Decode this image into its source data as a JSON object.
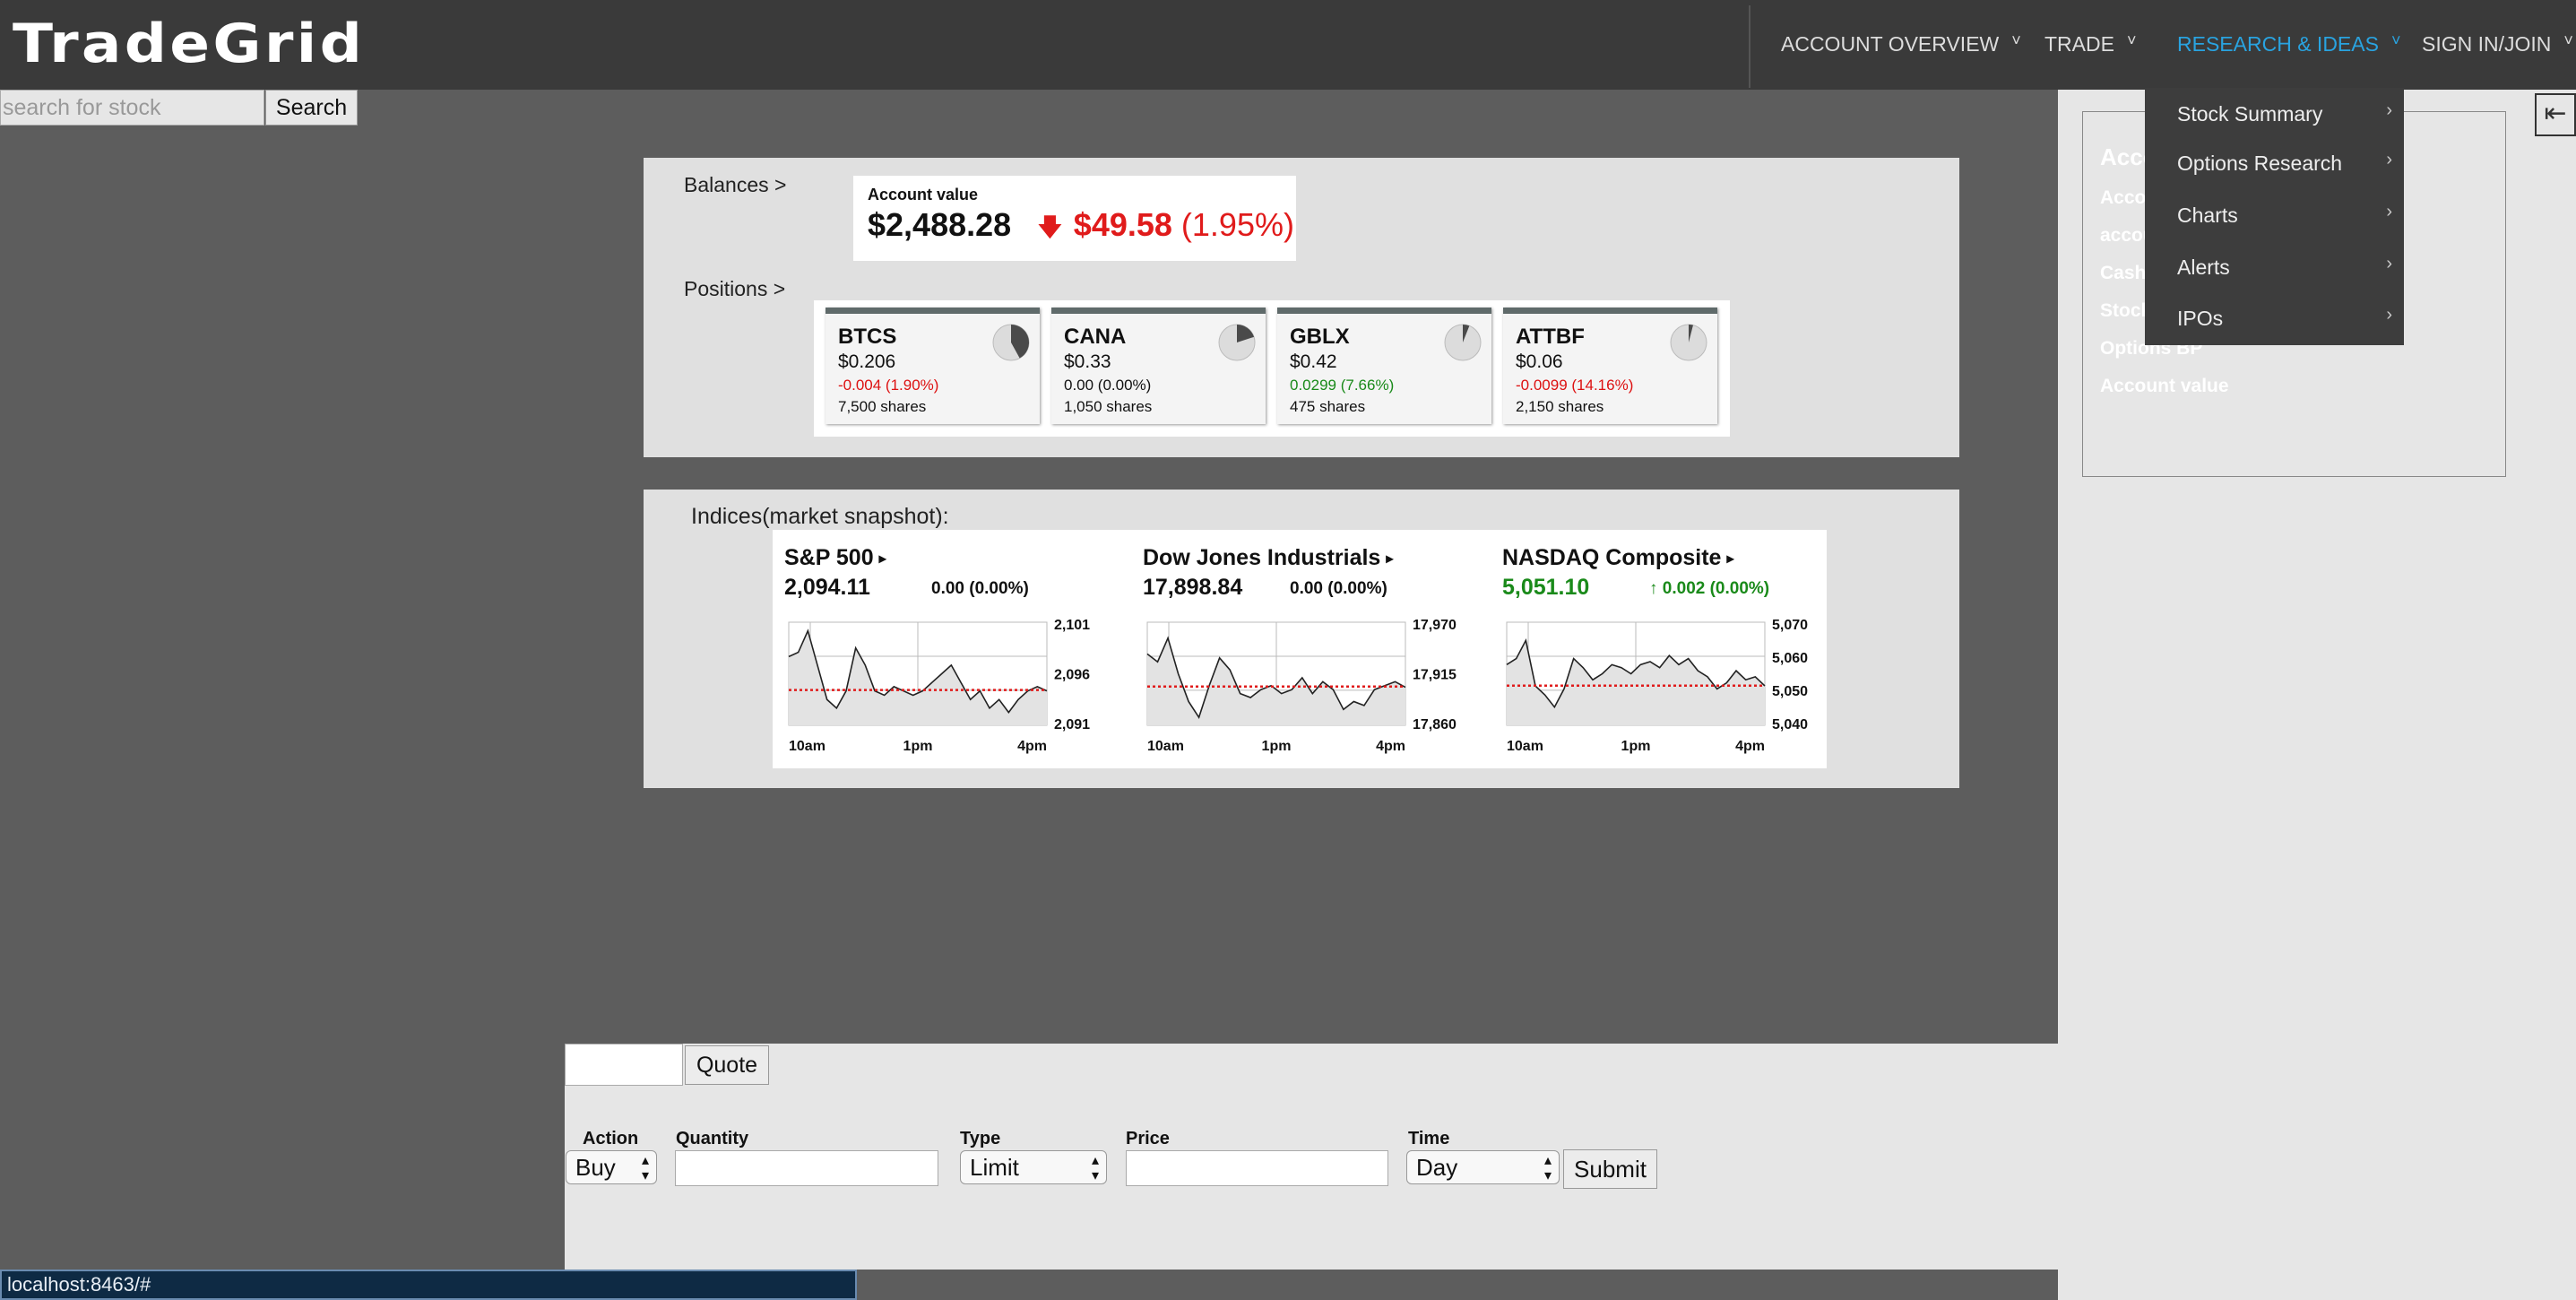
{
  "app": {
    "logo": "TradeGrid"
  },
  "nav": {
    "items": [
      {
        "label": "ACCOUNT OVERVIEW",
        "active": false
      },
      {
        "label": "TRADE",
        "active": false
      },
      {
        "label": "RESEARCH & IDEAS",
        "active": true
      },
      {
        "label": "SIGN IN/JOIN",
        "active": false
      }
    ],
    "chevron": "˅"
  },
  "dropdown": {
    "items": [
      "Stock Summary",
      "Options Research",
      "Charts",
      "Alerts",
      "IPOs"
    ],
    "chevron": "›"
  },
  "search": {
    "placeholder": "search for stock",
    "button": "Search"
  },
  "account_sidebar": {
    "lines": [
      "Acco",
      "Acco",
      "accou",
      "Cash",
      "Stock",
      "Options BP",
      "Account value"
    ],
    "collapse_icon": "⇤"
  },
  "balances": {
    "label": "Balances >",
    "account_value_label": "Account value",
    "account_value": "$2,488.28",
    "change_amount": "$49.58",
    "change_percent": "(1.95%)",
    "change_arrow": "🡇",
    "change_direction": "down"
  },
  "positions": {
    "label": "Positions >",
    "items": [
      {
        "symbol": "BTCS",
        "price": "$0.206",
        "change": "-0.004 (1.90%)",
        "direction": "neg",
        "shares": "7,500 shares",
        "pie_fraction": 0.42
      },
      {
        "symbol": "CANA",
        "price": "$0.33",
        "change": "0.00 (0.00%)",
        "direction": "flat",
        "shares": "1,050 shares",
        "pie_fraction": 0.2
      },
      {
        "symbol": "GBLX",
        "price": "$0.42",
        "change": "0.0299 (7.66%)",
        "direction": "pos",
        "shares": "475 shares",
        "pie_fraction": 0.06
      },
      {
        "symbol": "ATTBF",
        "price": "$0.06",
        "change": "-0.0099 (14.16%)",
        "direction": "neg",
        "shares": "2,150 shares",
        "pie_fraction": 0.04
      }
    ]
  },
  "indices": {
    "label": "Indices(market snapshot):",
    "items": [
      {
        "name": "S&P 500",
        "value": "2,094.11",
        "change": "0.00 (0.00%)",
        "direction": "flat",
        "yticks": [
          "2,101",
          "2,096",
          "2,091"
        ],
        "xticks": [
          "10am",
          "1pm",
          "4pm"
        ]
      },
      {
        "name": "Dow Jones Industrials",
        "value": "17,898.84",
        "change": "0.00 (0.00%)",
        "direction": "flat",
        "yticks": [
          "17,970",
          "17,915",
          "17,860"
        ],
        "xticks": [
          "10am",
          "1pm",
          "4pm"
        ]
      },
      {
        "name": "NASDAQ Composite",
        "value": "5,051.10",
        "change": "↑ 0.002 (0.00%)",
        "direction": "up",
        "yticks": [
          "5,070",
          "5,060",
          "5,050",
          "5,040"
        ],
        "xticks": [
          "10am",
          "1pm",
          "4pm"
        ]
      }
    ],
    "tri": "▸"
  },
  "chart_data": [
    {
      "type": "line",
      "title": "S&P 500",
      "xlabel": "",
      "ylabel": "",
      "xticks": [
        "10am",
        "1pm",
        "4pm"
      ],
      "ylim": [
        2090,
        2102
      ],
      "grid": true,
      "reference_line": 2094.11,
      "line_color": "#222222",
      "reference_color": "#e01b1b",
      "series": [
        {
          "values": [
            2098,
            2098.5,
            2101,
            2097,
            2093,
            2092,
            2094,
            2099,
            2097,
            2094,
            2093.5,
            2094.5,
            2094,
            2093.5,
            2094,
            2095,
            2096,
            2097,
            2095,
            2093,
            2094,
            2092,
            2093,
            2091.5,
            2093,
            2094,
            2094.5,
            2094
          ]
        }
      ]
    },
    {
      "type": "line",
      "title": "Dow Jones Industrials",
      "xlabel": "",
      "ylabel": "",
      "xticks": [
        "10am",
        "1pm",
        "4pm"
      ],
      "ylim": [
        17850,
        17980
      ],
      "grid": true,
      "reference_line": 17898.84,
      "line_color": "#222222",
      "reference_color": "#e01b1b",
      "series": [
        {
          "values": [
            17940,
            17930,
            17960,
            17915,
            17880,
            17860,
            17900,
            17935,
            17920,
            17890,
            17885,
            17895,
            17900,
            17890,
            17895,
            17910,
            17890,
            17905,
            17895,
            17870,
            17880,
            17875,
            17895,
            17900,
            17905,
            17898
          ]
        }
      ]
    },
    {
      "type": "line",
      "title": "NASDAQ Composite",
      "xlabel": "",
      "ylabel": "",
      "xticks": [
        "10am",
        "1pm",
        "4pm"
      ],
      "ylim": [
        5038,
        5072
      ],
      "grid": true,
      "reference_line": 5051.1,
      "line_color": "#222222",
      "reference_color": "#e01b1b",
      "series": [
        {
          "values": [
            5058,
            5060,
            5066,
            5051,
            5048,
            5044,
            5050,
            5060,
            5057,
            5053,
            5055,
            5058,
            5057,
            5055,
            5058,
            5059,
            5057,
            5061,
            5058,
            5060,
            5056,
            5054,
            5050,
            5052,
            5056,
            5053,
            5054,
            5051
          ]
        }
      ]
    }
  ],
  "trade": {
    "quote_button": "Quote",
    "action_label": "Action",
    "action_value": "Buy",
    "quantity_label": "Quantity",
    "type_label": "Type",
    "type_value": "Limit",
    "price_label": "Price",
    "time_label": "Time",
    "time_value": "Day",
    "submit": "Submit",
    "updown": "▴▾"
  },
  "status_bar": {
    "text": "localhost:8463/#"
  }
}
